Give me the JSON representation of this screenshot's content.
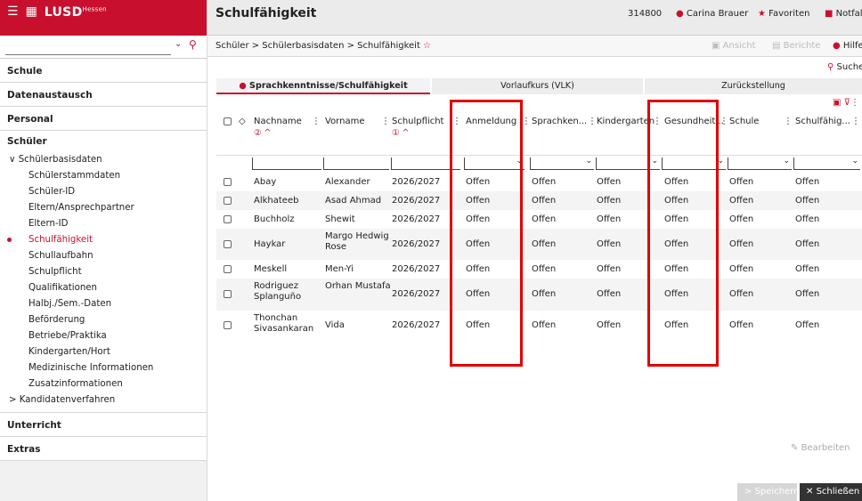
{
  "app": {
    "menu_icon": "hamburger-icon",
    "calendar_icon": "calendar-icon",
    "logo": "LUSD",
    "logo_sup": "Hessen"
  },
  "sidebar": {
    "search_placeholder": "",
    "sections_top": [
      "Schule",
      "Datenaustausch",
      "Personal"
    ],
    "schueler_header": "Schüler",
    "group_label": "Schülerbasisdaten",
    "items": [
      "Schülerstammdaten",
      "Schüler-ID",
      "Eltern/Ansprechpartner",
      "Eltern-ID",
      "Schulfähigkeit",
      "Schullaufbahn",
      "Schulpflicht",
      "Qualifikationen",
      "Halbj./Sem.-Daten",
      "Beförderung",
      "Betriebe/Praktika",
      "Kindergarten/Hort",
      "Medizinische Informationen",
      "Zusatzinformationen"
    ],
    "item_eltern_a": "Eltern/Ansprechpartner",
    "group2_label": "Kandidatenverfahren",
    "sections_bottom": [
      "Unterricht",
      "Extras"
    ]
  },
  "topbar": {
    "title": "Schulfähigkeit",
    "number": "314800",
    "user": "Carina Brauer",
    "favorites": "Favoriten",
    "notfall": "Notfal"
  },
  "breadcrumb": {
    "text": "Schüler > Schülerbasisdaten > Schulfähigkeit",
    "ansicht": "Ansicht",
    "berichte": "Berichte",
    "hilfe": "Hilfe"
  },
  "search_link": "Suche",
  "tabs": [
    "Sprachkenntnisse/Schulfähigkeit",
    "Vorlaufkurs (VLK)",
    "Zurückstellung"
  ],
  "table": {
    "headers": [
      "Nachname",
      "Vorname",
      "Schulpflicht",
      "Anmeldung",
      "Sprachken...",
      "Kindergarten",
      "Gesundheit...",
      "Schule",
      "Schulfähig..."
    ],
    "sort_nachname": "② ^",
    "sort_schulpflicht": "① ^",
    "rows": [
      [
        "Abay",
        "Alexander",
        "2026/2027",
        "Offen",
        "Offen",
        "Offen",
        "Offen",
        "Offen",
        "Offen"
      ],
      [
        "Alkhateeb",
        "Asad Ahmad",
        "2026/2027",
        "Offen",
        "Offen",
        "Offen",
        "Offen",
        "Offen",
        "Offen"
      ],
      [
        "Buchholz",
        "Shewit",
        "2026/2027",
        "Offen",
        "Offen",
        "Offen",
        "Offen",
        "Offen",
        "Offen"
      ],
      [
        "Haykar",
        "Margo Hedwig Rose",
        "2026/2027",
        "Offen",
        "Offen",
        "Offen",
        "Offen",
        "Offen",
        "Offen"
      ],
      [
        "Meskell",
        "Men-Yi",
        "2026/2027",
        "Offen",
        "Offen",
        "Offen",
        "Offen",
        "Offen",
        "Offen"
      ],
      [
        "Rodriguez Splanguño",
        "Orhan Mustafa",
        "2026/2027",
        "Offen",
        "Offen",
        "Offen",
        "Offen",
        "Offen",
        "Offen"
      ],
      [
        "Thonchan Sivasankaran",
        "Vida",
        "2026/2027",
        "Offen",
        "Offen",
        "Offen",
        "Offen",
        "Offen",
        "Offen"
      ]
    ]
  },
  "footer": {
    "bearbeiten": "Bearbeiten",
    "speichern": "Speichern",
    "schliessen": "Schließen"
  },
  "colors": {
    "brand": "#c8102e",
    "highlight": "#e00000"
  }
}
